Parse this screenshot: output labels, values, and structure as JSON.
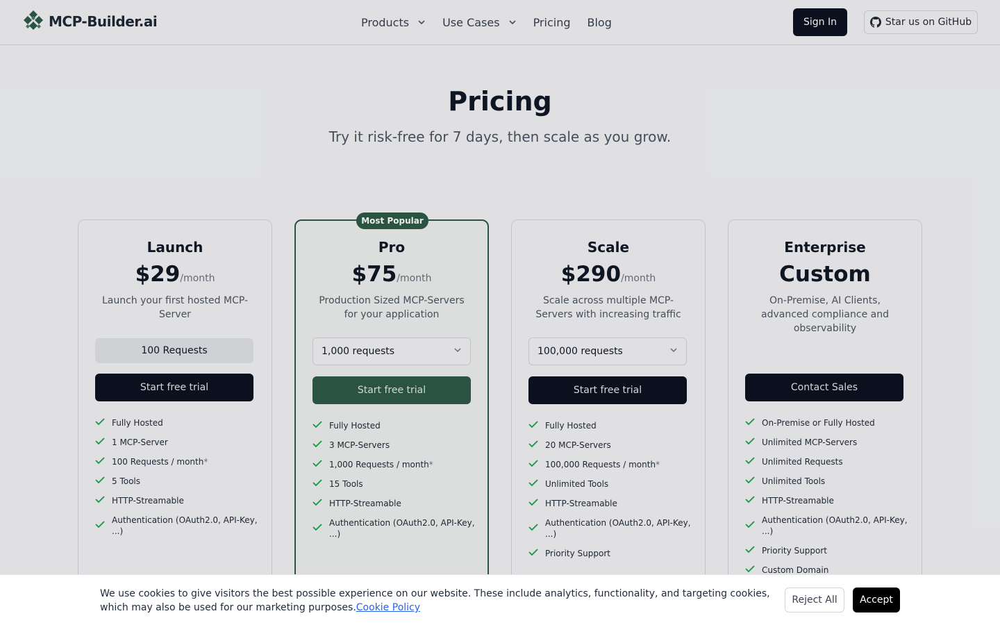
{
  "header": {
    "logo_text": "MCP-Builder.ai",
    "nav": {
      "products": "Products",
      "use_cases": "Use Cases",
      "pricing": "Pricing",
      "blog": "Blog"
    },
    "sign_in": "Sign In",
    "github": "Star us on GitHub"
  },
  "hero": {
    "title": "Pricing",
    "subtitle": "Try it risk-free for 7 days, then scale as you grow."
  },
  "plans": [
    {
      "name": "Launch",
      "price": "$29",
      "per": "/month",
      "desc": "Launch your first hosted MCP-Server",
      "requests": "100 Requests",
      "cta": "Start free trial",
      "features": [
        "Fully Hosted",
        "1 MCP-Server",
        "100 Requests / month",
        "5 Tools",
        "HTTP-Streamable",
        "Authentication (OAuth2.0, API-Key, ...)"
      ]
    },
    {
      "badge": "Most Popular",
      "name": "Pro",
      "price": "$75",
      "per": "/month",
      "desc": "Production Sized MCP-Servers for your application",
      "requests": "1,000 requests",
      "cta": "Start free trial",
      "features": [
        "Fully Hosted",
        "3 MCP-Servers",
        "1,000 Requests / month",
        "15 Tools",
        "HTTP-Streamable",
        "Authentication (OAuth2.0, API-Key, ...)"
      ]
    },
    {
      "name": "Scale",
      "price": "$290",
      "per": "/month",
      "desc": "Scale across multiple MCP-Servers with increasing traffic",
      "requests": "100,000 requests",
      "cta": "Start free trial",
      "features": [
        "Fully Hosted",
        "20 MCP-Servers",
        "100,000 Requests / month",
        "Unlimited Tools",
        "HTTP-Streamable",
        "Authentication (OAuth2.0, API-Key, ...)",
        "Priority Support"
      ]
    },
    {
      "name": "Enterprise",
      "price": "Custom",
      "desc": "On-Premise, AI Clients, advanced compliance and observability",
      "cta": "Contact Sales",
      "features": [
        "On-Premise or Fully Hosted",
        "Unlimited MCP-Servers",
        "Unlimited Requests",
        "Unlimited Tools",
        "HTTP-Streamable",
        "Authentication (OAuth2.0, API-Key, ...)",
        "Priority Support",
        "Custom Domain"
      ]
    }
  ],
  "asterisk": "*",
  "cookie": {
    "text": "We use cookies to give visitors the best possible experience on our website. These include analytics, functionality, and targeting cookies, which may also be used for our marketing purposes.",
    "link": "Cookie Policy",
    "reject": "Reject All",
    "accept": "Accept"
  },
  "colors": {
    "accent_green": "#2f5b47",
    "dark": "#0b1220",
    "check_green": "#16a34a"
  }
}
